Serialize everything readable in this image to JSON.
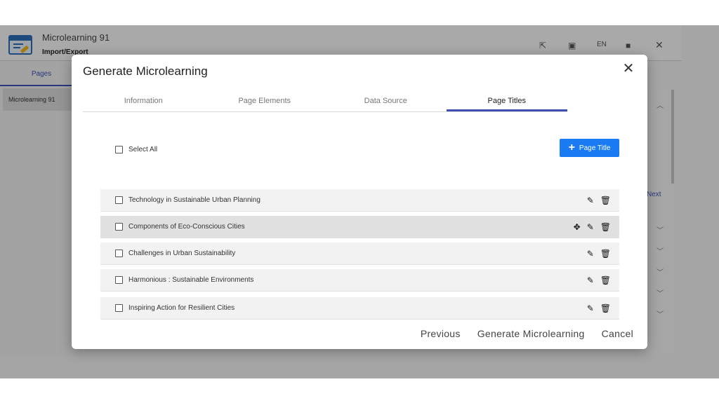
{
  "app": {
    "title": "Microlearning 91",
    "subtitle": "Import/Export",
    "header_icons": [
      "export-icon",
      "preview-icon",
      "save-icon",
      "close-icon"
    ],
    "lang": "EN",
    "left_tab": "Pages",
    "page_item": "Microlearning 91",
    "next_label": "Next"
  },
  "dialog": {
    "title": "Generate Microlearning",
    "tabs": [
      {
        "label": "Information",
        "active": false
      },
      {
        "label": "Page Elements",
        "active": false
      },
      {
        "label": "Data Source",
        "active": false
      },
      {
        "label": "Page Titles",
        "active": true
      }
    ],
    "select_all_label": "Select All",
    "add_button_label": "Page Title",
    "rows": [
      {
        "label": "Technology in Sustainable Urban Planning"
      },
      {
        "label": "Components of Eco-Conscious Cities"
      },
      {
        "label": "Challenges in Urban Sustainability"
      },
      {
        "label": "Harmonious : Sustainable Environments"
      },
      {
        "label": "Inspiring Action for Resilient Cities"
      }
    ],
    "footer": {
      "previous": "Previous",
      "generate": "Generate Microlearning",
      "cancel": "Cancel"
    }
  },
  "colors": {
    "accent": "#3f51b5",
    "button_blue": "#1a7bf2"
  }
}
